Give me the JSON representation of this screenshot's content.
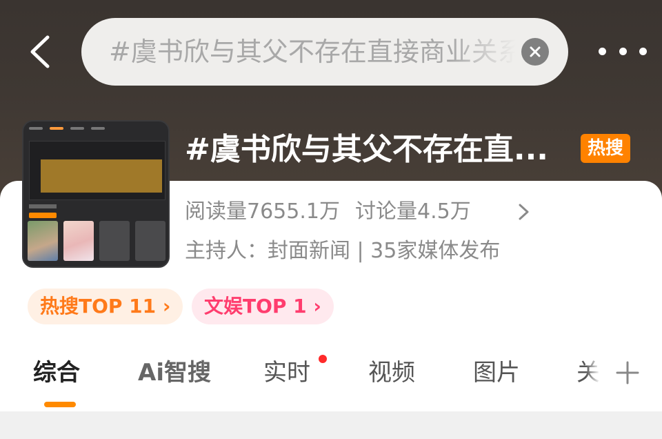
{
  "search": {
    "value": "#虞书欣与其父不存在直接商业关系#"
  },
  "topic": {
    "title": "#虞书欣与其父不存在直...",
    "badge": "热搜",
    "reads": "阅读量7655.1万",
    "discussions": "讨论量4.5万",
    "host": "主持人：封面新闻 | 35家媒体发布"
  },
  "ranks": {
    "hot": "热搜TOP 11 ›",
    "ent": "文娱TOP 1 ›"
  },
  "tabs": {
    "items": [
      "综合",
      "Ai智搜",
      "实时",
      "视频",
      "图片"
    ],
    "cut_label": "关",
    "active_index": 0
  },
  "colors": {
    "accent": "#ff8a00",
    "hot_badge": "#ff8200",
    "ent_tag": "#ff3d6e",
    "live_dot": "#ff2a2a"
  },
  "icons": [
    "back-arrow-icon",
    "clear-icon",
    "more-icon",
    "chevron-right-icon",
    "plus-icon"
  ]
}
